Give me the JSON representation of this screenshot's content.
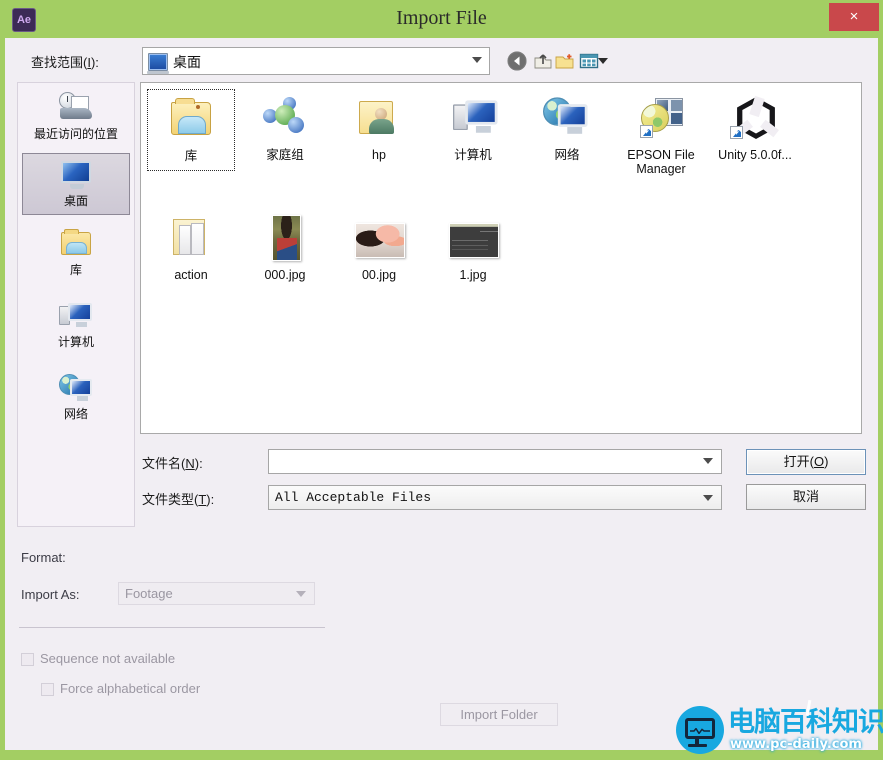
{
  "window": {
    "title": "Import File",
    "app_icon": "Ae",
    "close_label": "×",
    "frame_color": "#a3ce63",
    "titlebar_text_color": "#2a2a2a",
    "close_button_color": "#c9484b",
    "dialog_background": "#f1eef3"
  },
  "navigation": {
    "lookin_label_prefix": "查找范围(",
    "lookin_label_key": "I",
    "lookin_label_suffix": "):",
    "current_path": "桌面",
    "toolbar": [
      {
        "name": "back-icon",
        "tooltip": "返回"
      },
      {
        "name": "up-folder-icon",
        "tooltip": "向上一级"
      },
      {
        "name": "new-folder-icon",
        "tooltip": "新建文件夹"
      },
      {
        "name": "view-mode-icon",
        "tooltip": "查看"
      }
    ]
  },
  "places_bar": {
    "items": [
      {
        "label": "最近访问的位置",
        "icon": "recent-places-icon",
        "selected": false
      },
      {
        "label": "桌面",
        "icon": "desktop-icon",
        "selected": true
      },
      {
        "label": "库",
        "icon": "library-folder-icon",
        "selected": false
      },
      {
        "label": "计算机",
        "icon": "computer-icon",
        "selected": false
      },
      {
        "label": "网络",
        "icon": "network-icon",
        "selected": false
      }
    ]
  },
  "file_list": {
    "items": [
      {
        "label": "库",
        "icon": "library-folder-icon",
        "selected": true
      },
      {
        "label": "家庭组",
        "icon": "homegroup-icon",
        "selected": false
      },
      {
        "label": "hp",
        "icon": "user-folder-icon",
        "selected": false
      },
      {
        "label": "计算机",
        "icon": "computer-icon",
        "selected": false
      },
      {
        "label": "网络",
        "icon": "network-icon",
        "selected": false
      },
      {
        "label": "EPSON File Manager",
        "icon": "epson-file-manager-shortcut-icon",
        "selected": false
      },
      {
        "label": "Unity 5.0.0f...",
        "icon": "unity-shortcut-icon",
        "selected": false
      },
      {
        "label": "action",
        "icon": "plain-folder-icon",
        "selected": false
      },
      {
        "label": "000.jpg",
        "icon": "image-thumbnail-portrait",
        "selected": false
      },
      {
        "label": "00.jpg",
        "icon": "image-thumbnail-landscape",
        "selected": false
      },
      {
        "label": "1.jpg",
        "icon": "image-thumbnail-screenshot",
        "selected": false
      }
    ]
  },
  "form": {
    "filename_label_prefix": "文件名(",
    "filename_label_key": "N",
    "filename_label_suffix": "):",
    "filename_value": "",
    "filename_placeholder": "",
    "filetype_label_prefix": "文件类型(",
    "filetype_label_key": "T",
    "filetype_label_suffix": "):",
    "filetype_value": "All Acceptable Files",
    "open_button_prefix": "打开(",
    "open_button_key": "O",
    "open_button_suffix": ")",
    "cancel_button": "取消"
  },
  "format_section": {
    "format_label": "Format:",
    "format_value": "",
    "import_as_label": "Import As:",
    "import_as_value": "Footage",
    "checkbox_sequence": "Sequence not available",
    "checkbox_sequence_checked": false,
    "checkbox_force_alpha": "Force alphabetical order",
    "checkbox_force_alpha_checked": false,
    "import_folder_button": "Import Folder",
    "disabled_text_color": "#9b97a2"
  },
  "watermark": {
    "title": "电脑百科知识",
    "url": "www.pc-daily.com",
    "accent_color": "#18a8e0"
  }
}
